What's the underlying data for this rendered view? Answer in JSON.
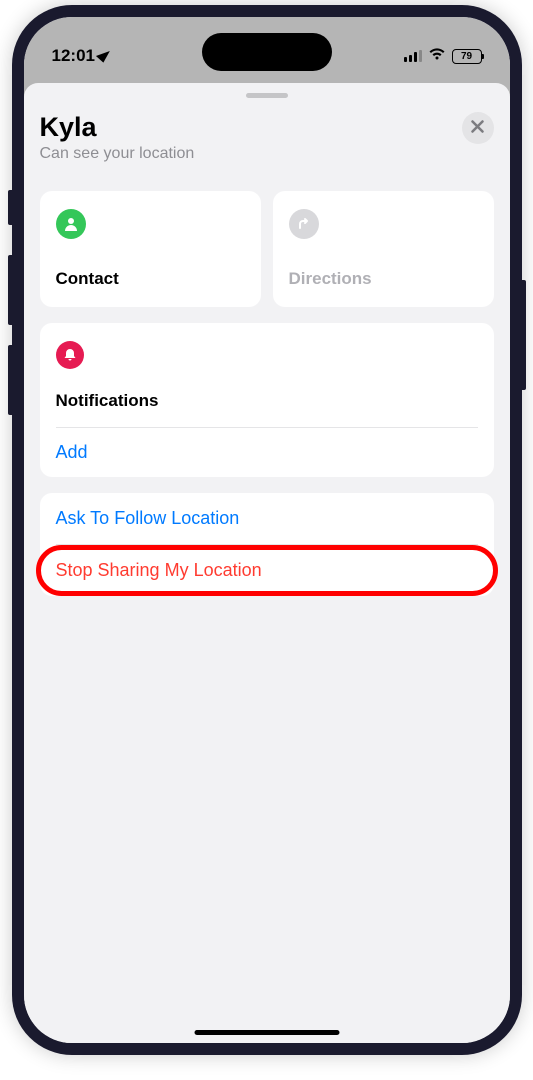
{
  "status": {
    "time": "12:01",
    "battery": "79"
  },
  "header": {
    "title": "Kyla",
    "subtitle": "Can see your location"
  },
  "tiles": {
    "contact": {
      "label": "Contact"
    },
    "directions": {
      "label": "Directions"
    }
  },
  "notifications": {
    "title": "Notifications",
    "add_label": "Add"
  },
  "actions": {
    "ask_follow": "Ask To Follow Location",
    "stop_sharing": "Stop Sharing My Location"
  }
}
